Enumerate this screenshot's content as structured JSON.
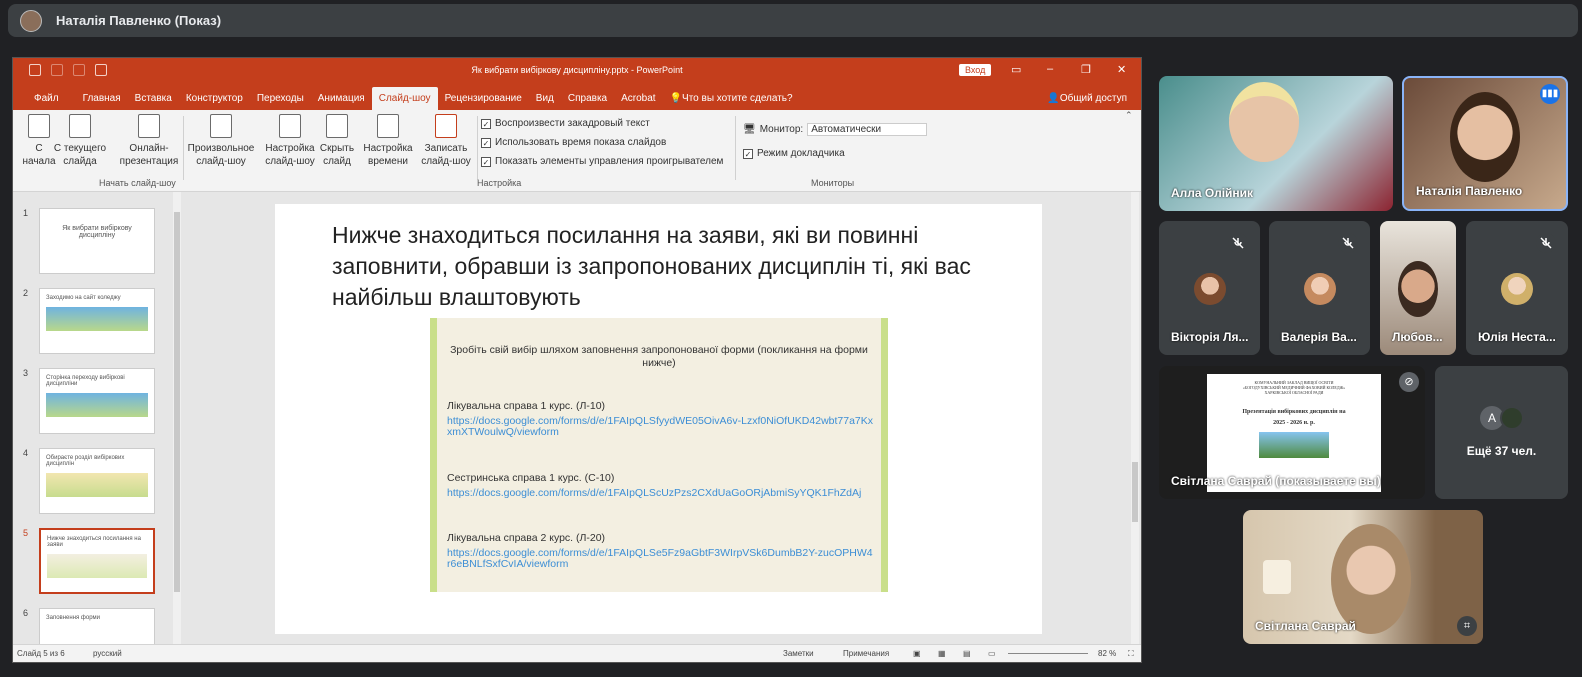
{
  "meeting": {
    "presenter_title": "Наталія Павленко (Показ)"
  },
  "ppt": {
    "doc_title": "Як вибрати вибіркову дисципліну.pptx - PowerPoint",
    "signin": "Вход",
    "tabs": [
      "Файл",
      "Главная",
      "Вставка",
      "Конструктор",
      "Переходы",
      "Анимация",
      "Слайд-шоу",
      "Рецензирование",
      "Вид",
      "Справка",
      "Acrobat",
      "Что вы хотите сделать?"
    ],
    "active_tab": "Слайд-шоу",
    "share": "Общий доступ",
    "ribbon": {
      "from_start": "С начала",
      "from_current": "С текущего слайда",
      "online": "Онлайн-презентация",
      "custom": "Произвольное слайд-шоу",
      "setup": "Настройка слайд-шоу",
      "hide": "Скрыть слайд",
      "timing": "Настройка времени",
      "record": "Записать слайд-шоу",
      "group_start": "Начать слайд-шоу",
      "chk_narration": "Воспроизвести закадровый текст",
      "chk_timings": "Использовать время показа слайдов",
      "chk_controls": "Показать элементы управления проигрывателем",
      "group_setup": "Настройка",
      "monitor_label": "Монитор:",
      "monitor_value": "Автоматически",
      "chk_presenter": "Режим докладчика",
      "group_monitors": "Мониторы"
    },
    "thumbs": [
      {
        "num": "1",
        "text": "Як вибрати вибіркову дисципліну"
      },
      {
        "num": "2",
        "text": "Заходимо на сайт коледжу"
      },
      {
        "num": "3",
        "text": "Сторінка переходу вибіркові дисципліни"
      },
      {
        "num": "4",
        "text": "Обираєте розділ вибіркових дисциплін"
      },
      {
        "num": "5",
        "text": "Нижче знаходиться посилання на заяви"
      },
      {
        "num": "6",
        "text": "Заповнення форми"
      }
    ],
    "slide": {
      "heading": "Нижче знаходиться посилання на заяви, які ви повинні заповнити, обравши із запропонованих дисциплін ті, які вас найбільш влаштовують",
      "image_header": "Зробіть свій вибір шляхом заповнення запропонованої форми (покликання на форми нижче)",
      "items": [
        {
          "label": "Лікувальна справа 1 курс. (Л-10)",
          "link": "https://docs.google.com/forms/d/e/1FAIpQLSfyydWE05OivA6v-Lzxf0NiOfUKD42wbt77a7KxxmXTWoulwQ/viewform"
        },
        {
          "label": "Сестринська справа 1 курс. (С-10)",
          "link": "https://docs.google.com/forms/d/e/1FAIpQLScUzPzs2CXdUaGoORjAbmiSyYQK1FhZdAj"
        },
        {
          "label": "Лікувальна справа 2 курс. (Л-20)",
          "link": "https://docs.google.com/forms/d/e/1FAIpQLSe5Fz9aGbtF3WIrpVSk6DumbB2Y-zucOPHW4r6eBNLfSxfCvIA/viewform"
        }
      ]
    },
    "status": {
      "slide": "Слайд 5 из 6",
      "lang": "русский",
      "notes": "Заметки",
      "comments": "Примечания",
      "zoom": "82 %"
    }
  },
  "participants": {
    "tile1": "Алла Олійник",
    "tile2": "Наталія Павленко",
    "tile3": "Вікторія Ля...",
    "tile4": "Валерія Ва...",
    "tile5": "Любов...",
    "tile6": "Юлія Неста...",
    "tile7": "Світлана Саврай (показываете вы)",
    "tile8_letter": "A",
    "tile8": "Ещё 37 чел.",
    "tile9": "Світлана Саврай"
  },
  "shared_slide": {
    "line1": "КОМУНАЛЬНИЙ ЗАКЛАД ВИЩОЇ ОСВІТИ",
    "line2": "«БОГОДУХІВСЬКИЙ МЕДИЧНИЙ ФАХОВИЙ КОЛЕДЖ»",
    "line3": "ХАРКІВСЬКОЇ ОБЛАСНОЇ РАДИ",
    "title": "Презентація вибіркових дисциплін на",
    "years": "2025 - 2026 н. р."
  },
  "colors": {
    "ppt_accent": "#c43e1c",
    "meet_bg": "#202124",
    "tile_bg": "#3c4043",
    "speaking_border": "#8ab4f8"
  }
}
